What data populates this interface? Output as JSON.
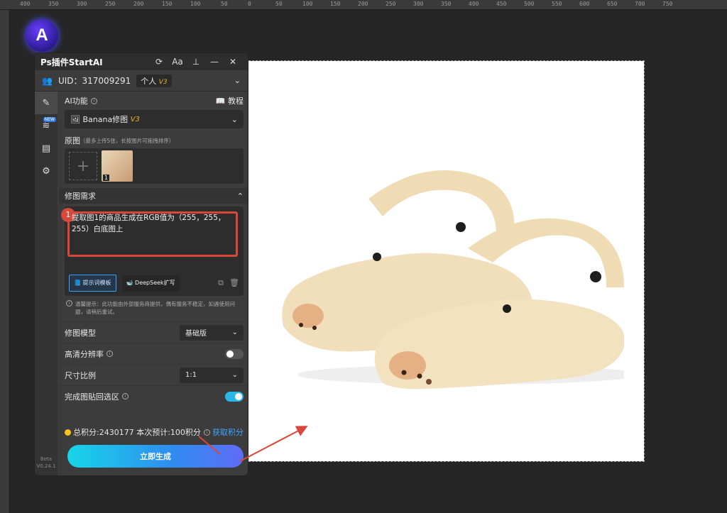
{
  "ruler": {
    "top": [
      "400",
      "350",
      "300",
      "250",
      "200",
      "150",
      "100",
      "50",
      "0",
      "50",
      "100",
      "150",
      "200",
      "250",
      "300",
      "350",
      "400",
      "450",
      "500",
      "550",
      "600",
      "650",
      "700",
      "750"
    ]
  },
  "panel": {
    "title": "Ps插件StartAI",
    "user": {
      "uid": "UID：317009291",
      "plan": "个人",
      "plan_version": "V3"
    },
    "sidebar": {
      "new_badge": "NEW",
      "version_line1": "Beta",
      "version_line2": "V0.24.1"
    },
    "ai_feature": {
      "label": "AI功能",
      "tutorial": "教程",
      "selected": "Banana修图",
      "selected_version": "V3"
    },
    "source_image": {
      "label": "原图",
      "hint": "（最多上传5张，长按图片可拖拽排序）",
      "thumb_index": "1"
    },
    "requirement": {
      "label": "修图需求",
      "badge": "1",
      "text": "提取图1的商品生成在RGB值为（255，255，255）白底图上",
      "prompt_template_button": "提示词模板",
      "deepseek_button": "DeepSeek扩写"
    },
    "tip": "温馨提示：此功能由外部服务商提供，偶有服务不稳定，如遇使用问题，请稍后重试。",
    "options": {
      "model_label": "修图模型",
      "model_value": "基础版",
      "hd_label": "高清分辨率",
      "ratio_label": "尺寸比例",
      "ratio_value": "1:1",
      "paste_label": "完成图贴回选区"
    },
    "footer": {
      "total_points": "总积分:2430177",
      "estimate": "本次预计:100积分",
      "get_points": "获取积分",
      "generate": "立即生成"
    }
  },
  "colors": {
    "accent": "#2f8cf0",
    "highlight": "#d7473a",
    "toggle_on": "#2bb6e6",
    "link": "#3aa7ff"
  }
}
